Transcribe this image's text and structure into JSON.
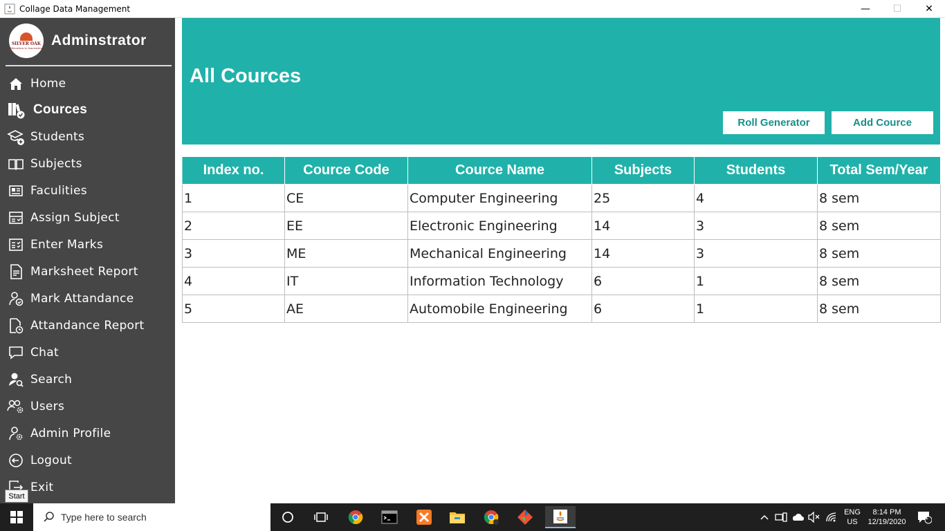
{
  "window": {
    "title": "Collage Data Management",
    "minimize_glyph": "—",
    "maximize_glyph": "☐",
    "close_glyph": "✕"
  },
  "sidebar": {
    "logo_text": "SILVER OAK",
    "logo_subtext": "Education to Innovation",
    "admin_name": "Adminstrator",
    "items": [
      {
        "label": "Home",
        "icon": "home-icon",
        "active": false
      },
      {
        "label": "Cources",
        "icon": "books-check-icon",
        "active": true
      },
      {
        "label": "Students",
        "icon": "graduate-add-icon",
        "active": false
      },
      {
        "label": "Subjects",
        "icon": "open-book-icon",
        "active": false
      },
      {
        "label": "Faculities",
        "icon": "id-card-icon",
        "active": false
      },
      {
        "label": "Assign Subject",
        "icon": "assign-list-icon",
        "active": false
      },
      {
        "label": "Enter Marks",
        "icon": "checklist-icon",
        "active": false
      },
      {
        "label": "Marksheet Report",
        "icon": "report-document-icon",
        "active": false
      },
      {
        "label": "Mark Attandance",
        "icon": "attendance-person-icon",
        "active": false
      },
      {
        "label": "Attandance Report",
        "icon": "document-clock-icon",
        "active": false
      },
      {
        "label": "Chat",
        "icon": "chat-bubble-icon",
        "active": false
      },
      {
        "label": "Search",
        "icon": "user-search-icon",
        "active": false
      },
      {
        "label": "Users",
        "icon": "users-settings-icon",
        "active": false
      },
      {
        "label": "Admin Profile",
        "icon": "user-gear-icon",
        "active": false
      },
      {
        "label": "Logout",
        "icon": "logout-icon",
        "active": false
      },
      {
        "label": "Exit",
        "icon": "exit-icon",
        "active": false
      }
    ],
    "tooltip": "Start"
  },
  "header": {
    "title": "All Cources",
    "roll_button": "Roll Generator",
    "add_button": "Add Cource",
    "color": "#20b2aa"
  },
  "table": {
    "columns": [
      "Index no.",
      "Cource Code",
      "Cource Name",
      "Subjects",
      "Students",
      "Total Sem/Year"
    ],
    "rows": [
      [
        "1",
        "CE",
        "Computer Engineering",
        "25",
        "4",
        "8 sem"
      ],
      [
        "2",
        "EE",
        "Electronic Engineering",
        "14",
        "3",
        "8 sem"
      ],
      [
        "3",
        "ME",
        "Mechanical Engineering",
        "14",
        "3",
        "8 sem"
      ],
      [
        "4",
        "IT",
        "Information Technology",
        "6",
        "1",
        "8 sem"
      ],
      [
        "5",
        "AE",
        "Automobile Engineering",
        "6",
        "1",
        "8 sem"
      ]
    ]
  },
  "taskbar": {
    "search_placeholder": "Type here to search",
    "lang_1": "ENG",
    "lang_2": "US",
    "time": "8:14 PM",
    "date": "12/19/2020",
    "notification_count": "1"
  }
}
